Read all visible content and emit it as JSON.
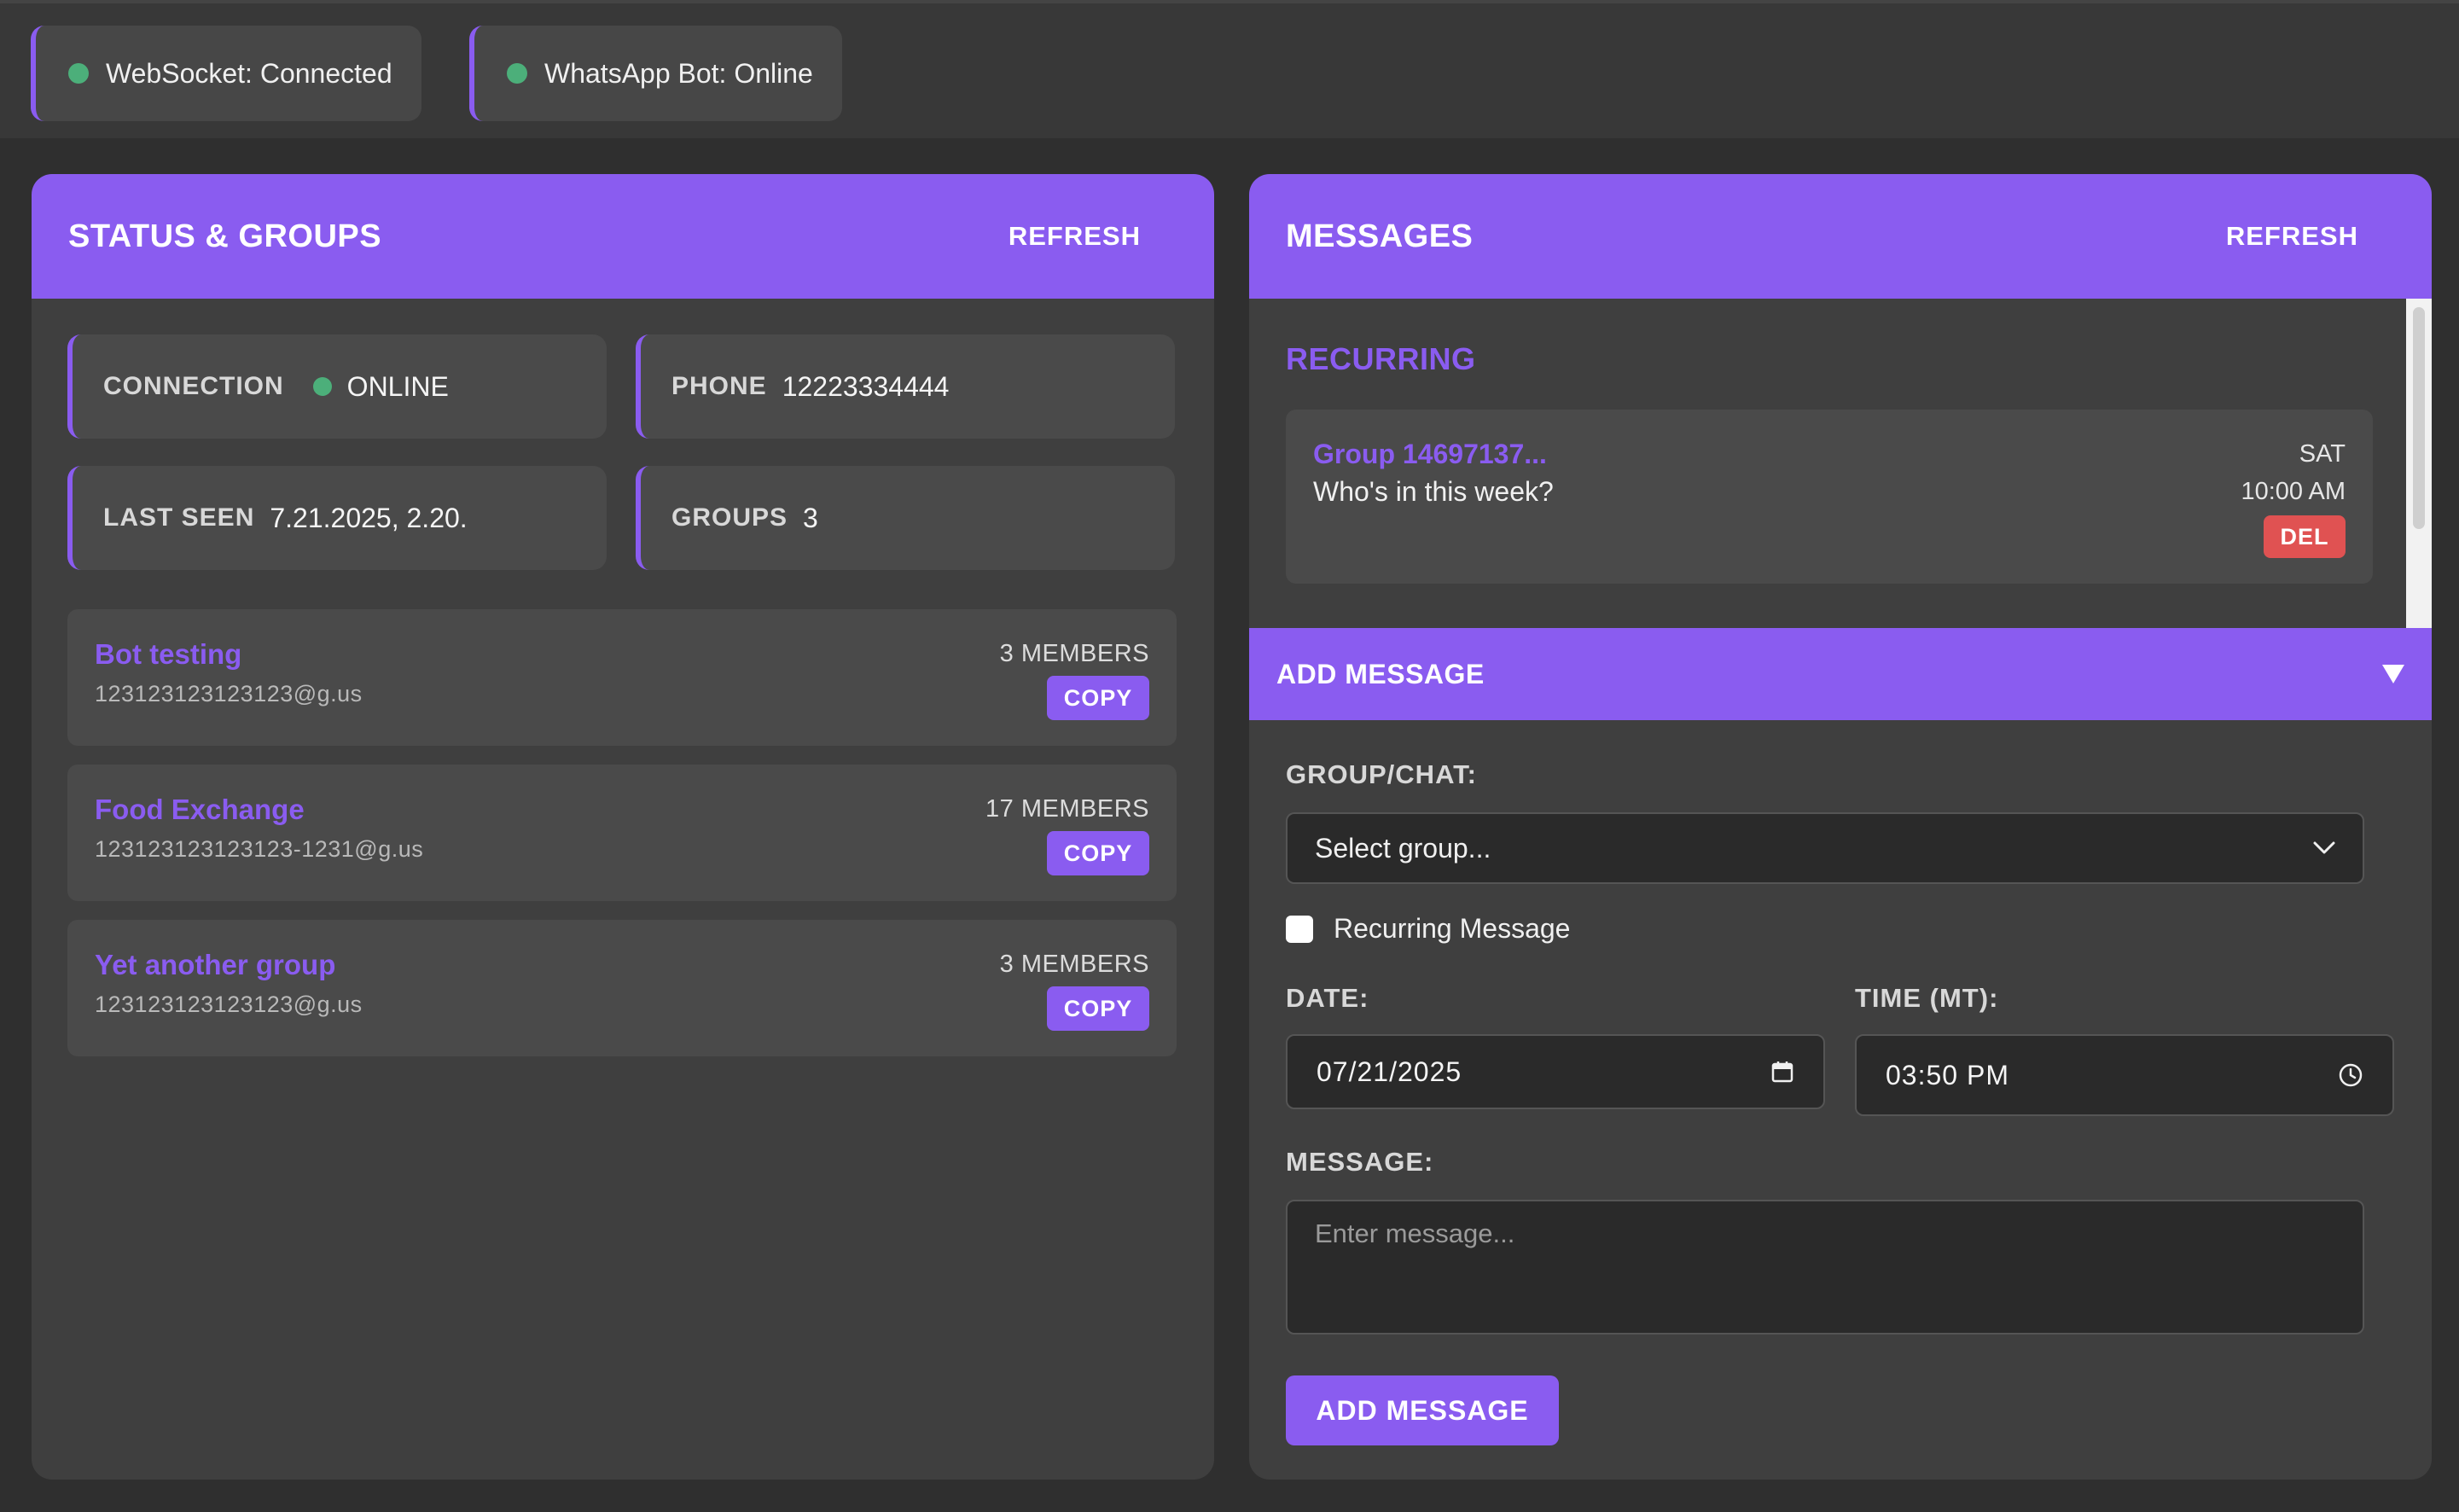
{
  "status_bar": {
    "websocket": "WebSocket: Connected",
    "bot": "WhatsApp Bot: Online"
  },
  "left_panel": {
    "title": "STATUS & GROUPS",
    "refresh_label": "REFRESH",
    "stats": {
      "connection": {
        "label": "CONNECTION",
        "value": "ONLINE"
      },
      "phone": {
        "label": "PHONE",
        "value": "12223334444"
      },
      "last_seen": {
        "label": "LAST SEEN",
        "value": "7.21.2025, 2.20."
      },
      "groups": {
        "label": "GROUPS",
        "value": "3"
      }
    },
    "groups": [
      {
        "name": "Bot testing",
        "id": "123123123123123@g.us",
        "members": "3 MEMBERS",
        "copy_label": "COPY"
      },
      {
        "name": "Food Exchange",
        "id": "123123123123123-1231@g.us",
        "members": "17 MEMBERS",
        "copy_label": "COPY"
      },
      {
        "name": "Yet another group",
        "id": "123123123123123@g.us",
        "members": "3 MEMBERS",
        "copy_label": "COPY"
      }
    ]
  },
  "right_panel": {
    "title": "MESSAGES",
    "refresh_label": "REFRESH",
    "recurring_title": "RECURRING",
    "recurring": [
      {
        "group": "Group 14697137...",
        "text": "Who's in this week?",
        "day": "SAT",
        "time": "10:00 AM",
        "delete_label": "DEL"
      }
    ],
    "add_message": {
      "header": "ADD MESSAGE",
      "group_label": "GROUP/CHAT:",
      "group_select_value": "Select group...",
      "recurring_checkbox_label": "Recurring Message",
      "recurring_checked": false,
      "date_label": "DATE:",
      "date_value": "07/21/2025",
      "time_label": "TIME (MT):",
      "time_value": "03:50 PM",
      "message_label": "MESSAGE:",
      "message_placeholder": "Enter message...",
      "submit_label": "ADD MESSAGE"
    }
  },
  "colors": {
    "accent": "#8a5cf0",
    "online": "#4caf7a",
    "danger": "#e05252",
    "background": "#2f2f2f",
    "panel": "#3f3f3f"
  }
}
